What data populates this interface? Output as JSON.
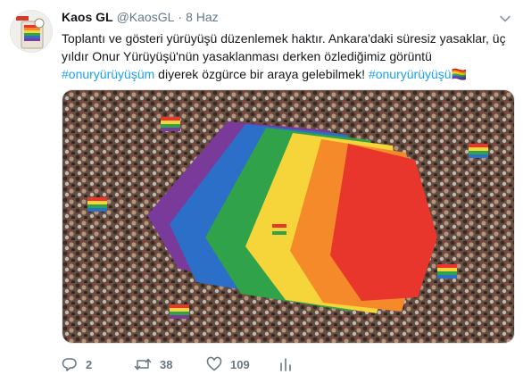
{
  "tweet": {
    "author_name": "Kaos GL",
    "handle": "@KaosGL",
    "separator": "·",
    "date": "8 Haz",
    "text_lines": [
      "Toplantı ve gösteri yürüyüşü düzenlemek haktır. Ankara'daki süresiz yasaklar, üç",
      "yıldır Onur Yürüyüşü'nün yasaklanması derken özlediğimiz görüntü"
    ],
    "hashtag_1": "#onuryürüyüşüm",
    "text_mid": " diyerek özgürce bir araya gelebilmek! ",
    "hashtag_2": "#onuryürüyüşü",
    "emoji": "🏳️‍🌈",
    "media_alt": "Onur Yürüyüşü photo",
    "avatar_label": "Kaos GL logo"
  },
  "actions": {
    "reply_count": "2",
    "retweet_count": "38",
    "like_count": "109"
  },
  "icons": {
    "reply": "reply-icon",
    "retweet": "retweet-icon",
    "like": "heart-icon",
    "analytics": "analytics-icon",
    "menu": "chevron-down-icon"
  },
  "colors": {
    "hashtag": "#1da1f2",
    "action_grey": "#657786",
    "flag_red": "#e8362c",
    "flag_orange": "#f58a2a",
    "flag_yellow": "#f6d53a",
    "flag_green": "#2fa24a",
    "flag_blue": "#2b6fc9",
    "flag_purple": "#7a3a9a"
  }
}
